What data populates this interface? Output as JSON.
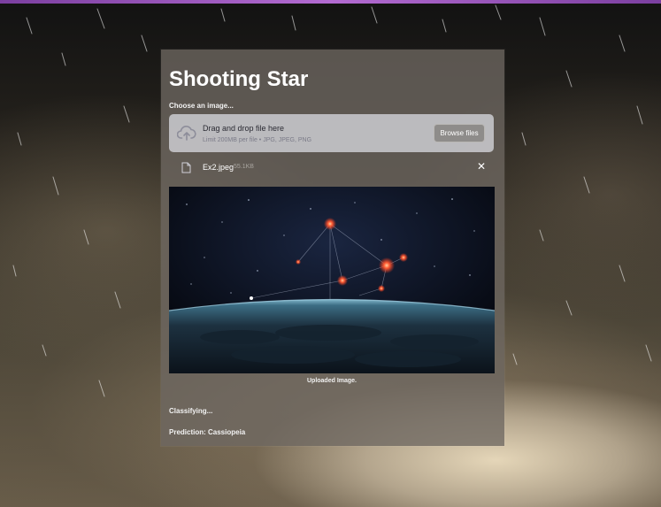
{
  "app": {
    "title": "Shooting Star",
    "accent_color": "#7b3fa0"
  },
  "uploader": {
    "label": "Choose an image...",
    "dropzone_title": "Drag and drop file here",
    "dropzone_limit": "Limit 200MB per file • JPG, JPEG, PNG",
    "browse_button": "Browse files",
    "upload_icon": "cloud-upload-icon"
  },
  "file": {
    "name": "Ex2.jpeg",
    "size": "55.1KB",
    "icon": "file-icon",
    "remove_icon": "close-icon",
    "remove_glyph": "✕"
  },
  "image": {
    "caption": "Uploaded Image."
  },
  "status": {
    "classifying": "Classifying...",
    "prediction": "Prediction: Cassiopeia"
  }
}
